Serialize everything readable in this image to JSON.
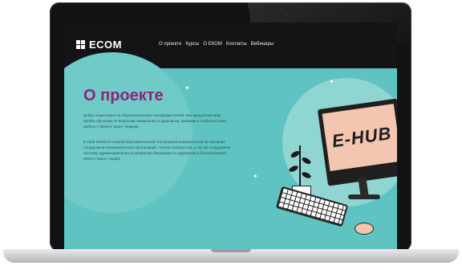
{
  "brand": {
    "name": "ECOM"
  },
  "nav": {
    "links": [
      "О проекте",
      "Курсы",
      "О ЕКОМ",
      "Контакты",
      "Вебинары"
    ]
  },
  "hero": {
    "title": "О проекте",
    "paragraph1": "Добро пожаловать на образовательную платформу EKOM. Мы предлагаем вам пройти обучение по вопросам связанным со здоровьем, правами и особенностями работы с МСМ и транс* людьми.",
    "paragraph2": "E-HUB является первой образовательной платформой направленной на обучение сотрудников некоммерческих организаций, членов сообщества, а так же сотрудников системы здравоохранения по вопросам связанным со здоровьем и благополучием МСМ и транс* людей."
  },
  "illustration": {
    "monitor_text": "E-HUB"
  },
  "icons": [
    "logo-grid-icon",
    "plant-icon",
    "monitor-icon",
    "keyboard-icon",
    "mouse-icon"
  ],
  "colors": {
    "background": "#5ec3c1",
    "title": "#8a2779",
    "navbar": "#141416",
    "monitor_screen": "#f2c6b0"
  }
}
